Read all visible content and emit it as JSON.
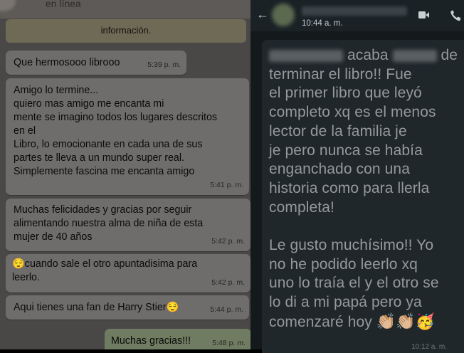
{
  "left_chat": {
    "header_status": "en línea",
    "info_banner": "información.",
    "messages": [
      {
        "text": "Que hermosooo librooo",
        "time": "5:39 p. m."
      },
      {
        "text": "Amigo lo termine...\nquiero mas amigo me encanta mi\nmente se imagino todos los lugares descritos\nen el\nLibro, lo emocionante en cada una de sus\npartes te lleva a un mundo super real.\nSimplemente fascina me encanta amigo",
        "time": "5:41 p. m."
      },
      {
        "text": "Muchas felicidades y gracias por seguir\nalimentando nuestra alma de niña de esta\nmujer de 40 años",
        "time": "5:42 p. m."
      },
      {
        "text": "😌cuando sale el otro apuntadisima para\nleerlo.",
        "time": "5:42 p. m."
      },
      {
        "text": "Aqui tienes una fan de Harry Stier😌",
        "time": "5:44 p. m."
      }
    ],
    "outgoing": {
      "text": "Muchas gracias!!!",
      "time": "5:48 p. m."
    }
  },
  "right_chat": {
    "header_time": "10:44 a. m.",
    "message_line1": "acaba",
    "message_rest": "de terminar el libro!! Fue\nel primer libro que leyó\ncompleto xq es el menos\nlector de la familia je\nje pero nunca se había\nenganchado con una\nhistoria como para llerla\ncompleta!\n\nLe gusto muchísimo!! Yo\nno he podido leerlo xq\nuno lo traía el y el otro se\nlo di a mi papá pero ya\ncomenzaré hoy",
    "emojis": "👏🏼👏🏼🥳",
    "footer_time": "10:12 a. m."
  },
  "icons": {
    "back": "arrow-left-icon",
    "video": "video-camera-icon",
    "call": "phone-icon"
  },
  "colors": {
    "dark_bg": "#14191c",
    "light_bg_dimmed": "#4a4846",
    "text_dark_mode": "#95999b"
  }
}
